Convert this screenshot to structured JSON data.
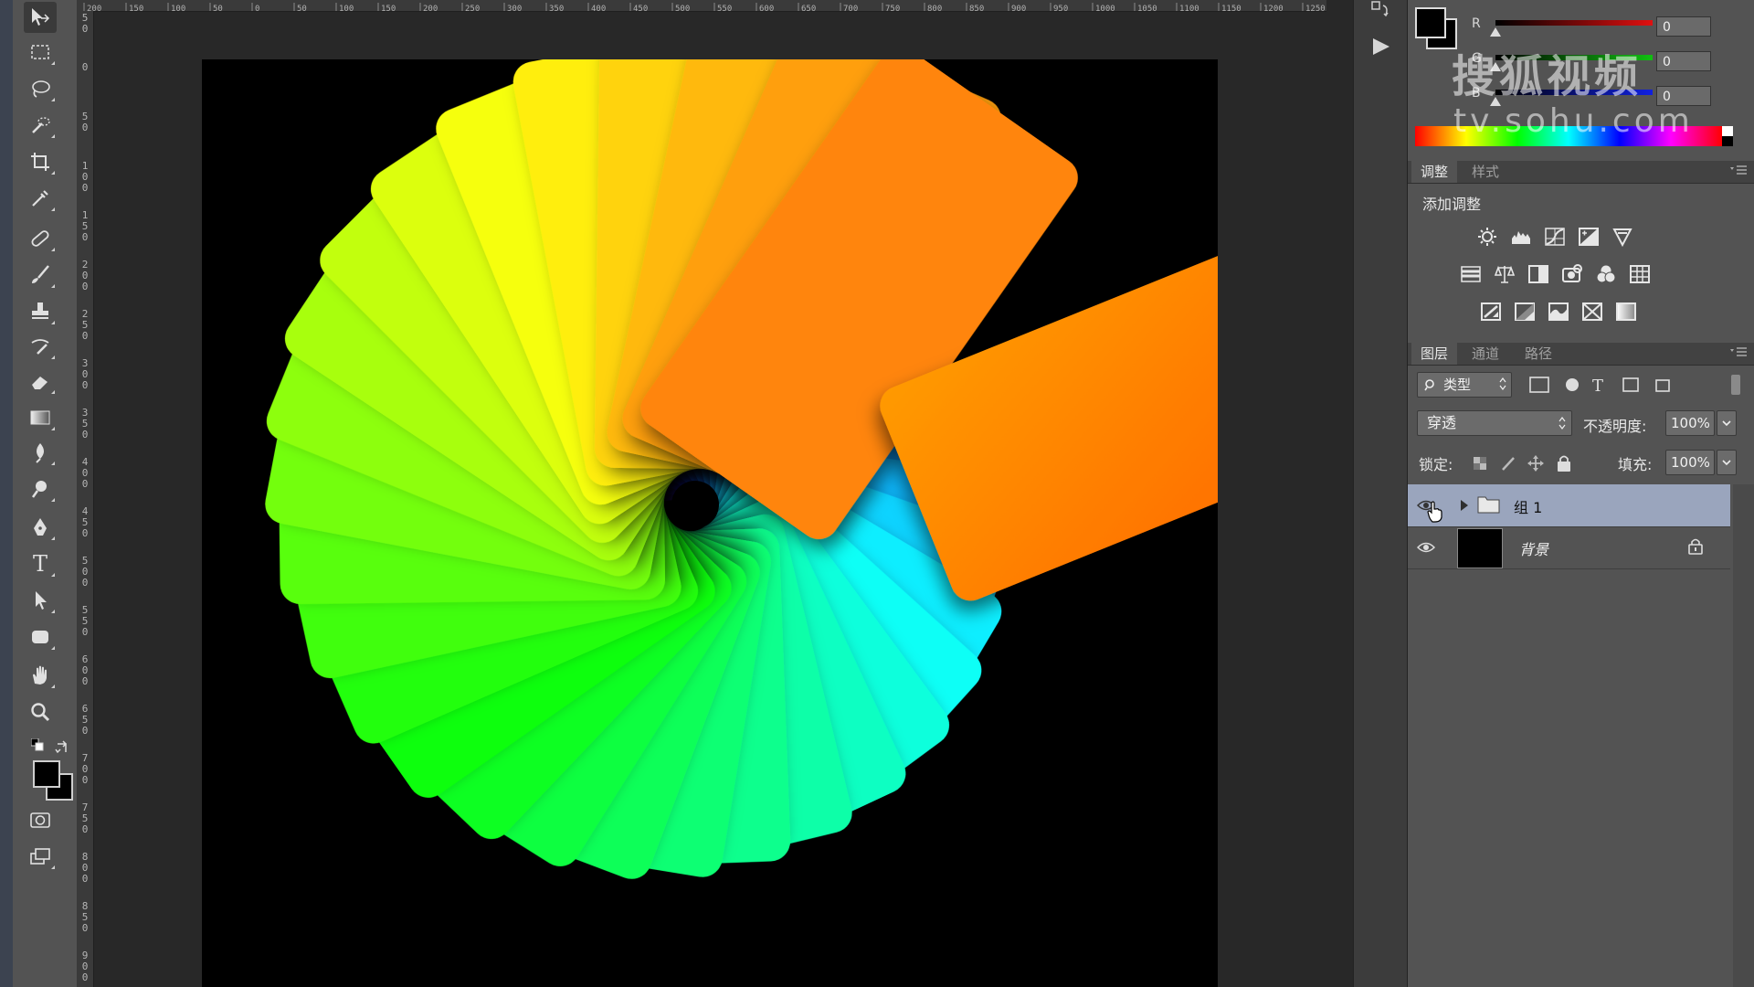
{
  "ruler": {
    "top_labels": [
      "200",
      "150",
      "100",
      "50",
      "0",
      "50",
      "100",
      "150",
      "200",
      "250",
      "300",
      "350",
      "400",
      "450",
      "500",
      "550",
      "600",
      "650",
      "700",
      "750",
      "800",
      "850",
      "900",
      "950",
      "1000",
      "1050",
      "1100",
      "1150",
      "1200",
      "1250"
    ],
    "left_labels": [
      "50",
      "0",
      "50",
      "100",
      "150",
      "200",
      "250",
      "300",
      "350",
      "400",
      "450",
      "500",
      "550",
      "600",
      "650",
      "700",
      "750",
      "800",
      "850",
      "900"
    ]
  },
  "tools": [
    "move-tool",
    "marquee-tool",
    "lasso-tool",
    "quick-select-tool",
    "crop-tool",
    "eyedropper-tool",
    "healing-brush-tool",
    "brush-tool",
    "clone-stamp-tool",
    "history-brush-tool",
    "eraser-tool",
    "gradient-tool",
    "blur-tool",
    "dodge-tool",
    "pen-tool",
    "type-tool",
    "path-select-tool",
    "shape-tool",
    "hand-tool",
    "zoom-tool"
  ],
  "type_tool_glyph": "T",
  "color_panel": {
    "channels": [
      {
        "label": "R",
        "value": "0",
        "color": "#e01010"
      },
      {
        "label": "G",
        "value": "0",
        "color": "#10c010"
      },
      {
        "label": "B",
        "value": "0",
        "color": "#1020e0"
      }
    ]
  },
  "watermark": {
    "line1": "搜狐视频",
    "line2": "tv.sohu.com"
  },
  "adjustments_panel": {
    "tabs": [
      "调整",
      "样式"
    ],
    "active_tab": "调整",
    "heading": "添加调整",
    "icons": [
      [
        "brightness-contrast-icon",
        "levels-icon",
        "curves-icon",
        "exposure-icon",
        "vibrance-icon"
      ],
      [
        "hue-saturation-icon",
        "color-balance-icon",
        "black-white-icon",
        "photo-filter-icon",
        "channel-mixer-icon",
        "color-lookup-icon"
      ],
      [
        "invert-icon",
        "posterize-icon",
        "threshold-icon",
        "selective-color-icon",
        "gradient-map-icon"
      ]
    ]
  },
  "layers_panel": {
    "tabs": [
      "图层",
      "通道",
      "路径"
    ],
    "active_tab": "图层",
    "filter_kind": "类型",
    "blend_mode": "穿透",
    "opacity_label": "不透明度:",
    "opacity_value": "100%",
    "lock_label": "锁定:",
    "fill_label": "填充:",
    "fill_value": "100%",
    "layers": [
      {
        "name": "组 1",
        "type": "group",
        "visible": true,
        "selected": true
      },
      {
        "name": "背景",
        "type": "background",
        "visible": true,
        "selected": false,
        "locked": true
      }
    ]
  },
  "colors": {
    "panel_bg": "#535353",
    "selected_layer": "#9aa5bd",
    "canvas_bg": "#000000"
  }
}
